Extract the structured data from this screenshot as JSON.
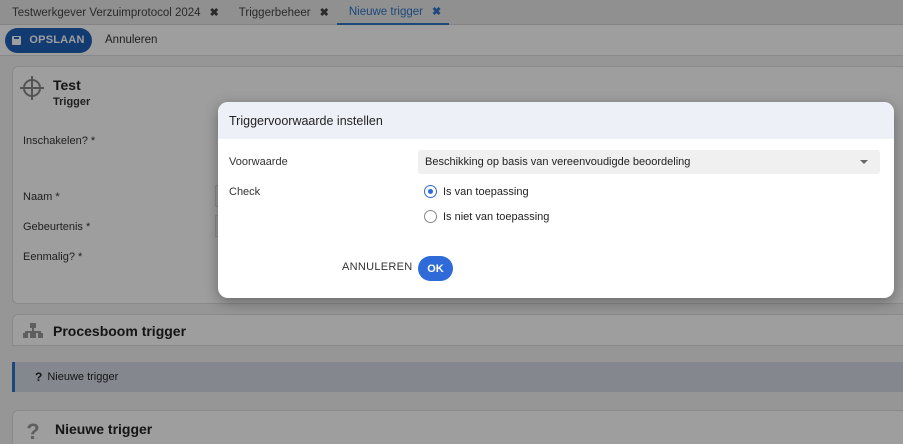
{
  "tabs": [
    {
      "label": "Testwerkgever Verzuimprotocol 2024",
      "active": false
    },
    {
      "label": "Triggerbeheer",
      "active": false
    },
    {
      "label": "Nieuwe trigger",
      "active": true
    }
  ],
  "tab_close_glyph": "✖",
  "toolbar": {
    "save_label": "OPSLAAN",
    "cancel_label": "Annuleren"
  },
  "trigger_card": {
    "title": "Test",
    "subtitle": "Trigger",
    "fields": {
      "enabled": "Inschakelen? *",
      "name": "Naam *",
      "event": "Gebeurtenis *",
      "once": "Eenmalig? *"
    }
  },
  "process_card": {
    "title": "Procesboom trigger",
    "tree_item": "Nieuwe trigger",
    "tree_item_marker": "?"
  },
  "new_trigger_card": {
    "title": "Nieuwe trigger",
    "marker": "?"
  },
  "dialog": {
    "title": "Triggervoorwaarde instellen",
    "condition_label": "Voorwaarde",
    "condition_value": "Beschikking op basis van vereenvoudigde beoordeling",
    "check_label": "Check",
    "options": [
      {
        "label": "Is van toepassing",
        "selected": true
      },
      {
        "label": "Is niet van toepassing",
        "selected": false
      }
    ],
    "cancel_label": "ANNULEREN",
    "ok_label": "OK"
  },
  "colors": {
    "accent": "#2e6ad8",
    "save_button": "#1e5fb8",
    "active_tab": "#2e74c9"
  }
}
